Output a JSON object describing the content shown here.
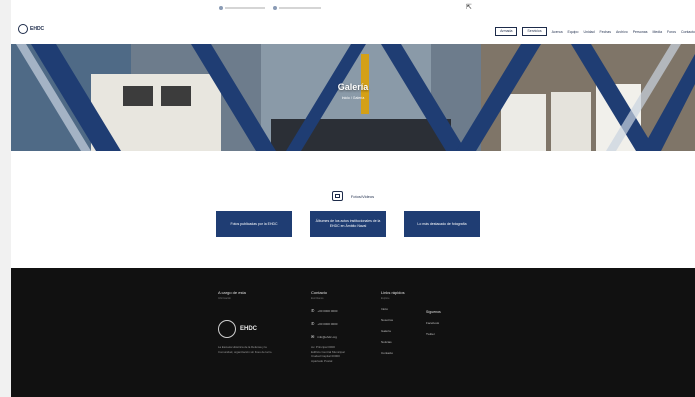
{
  "colors": {
    "navy": "#1f3d73",
    "dark_footer": "#111111",
    "header_text": "#1d2b4a"
  },
  "header": {
    "logo_text": "EHDC",
    "nav_buttons": [
      "Armada",
      "Servicios"
    ],
    "nav_items": [
      "Acerca",
      "Equipo",
      "Unidad",
      "Fechas",
      "Archivo",
      "Personas",
      "Media",
      "Foros",
      "Contacto"
    ]
  },
  "hero": {
    "title": "Galería",
    "subtitle": "Inicio / Galería"
  },
  "media": {
    "icon": "photo-gallery-icon",
    "title": "Fotos/Videos",
    "tiles": [
      "Fotos publicadas por la EHDC",
      "Álbumes de los actos institucionales de la EHDC en Ámbito Naval",
      "Lo más destacado de fotografía"
    ]
  },
  "footer": {
    "col1_title": "A cargo de esta",
    "col1_sub": "Información",
    "brand": "EHDC",
    "about": "La Escuela Histórica de la Defensa y la Comunidad, organización sin fines de lucro.",
    "col2_title": "Contacto",
    "col2_sub": "Escríbanos",
    "contact": [
      {
        "icon": "phone-icon",
        "text": "+00 0000 0000"
      },
      {
        "icon": "phone-icon",
        "text": "+00 0000 0000"
      },
      {
        "icon": "mail-icon",
        "text": "info@ehdc.org"
      }
    ],
    "address": [
      "Av. Principal 0000",
      "Edificio Central Municipal",
      "Ciudad Capital 00000",
      "Apartado Postal"
    ],
    "col3_title": "Links rápidos",
    "col3_sub": "Explore",
    "links": [
      "Inicio",
      "Nosotros",
      "Galería",
      "Noticias",
      "Contacto"
    ],
    "col4_title": "Síguenos",
    "social": [
      "Facebook",
      "Twitter"
    ]
  }
}
